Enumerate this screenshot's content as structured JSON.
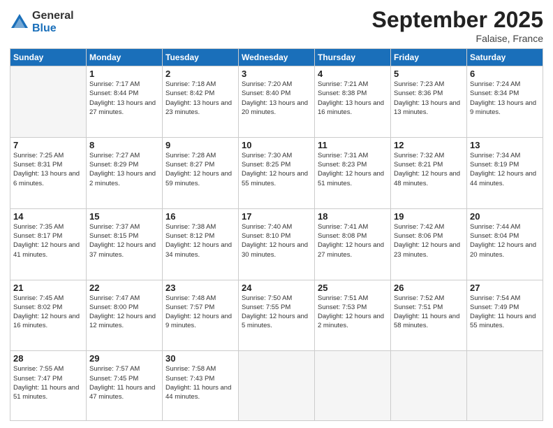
{
  "logo": {
    "general": "General",
    "blue": "Blue"
  },
  "title": "September 2025",
  "location": "Falaise, France",
  "days_of_week": [
    "Sunday",
    "Monday",
    "Tuesday",
    "Wednesday",
    "Thursday",
    "Friday",
    "Saturday"
  ],
  "weeks": [
    [
      {
        "day": "",
        "info": ""
      },
      {
        "day": "1",
        "info": "Sunrise: 7:17 AM\nSunset: 8:44 PM\nDaylight: 13 hours\nand 27 minutes."
      },
      {
        "day": "2",
        "info": "Sunrise: 7:18 AM\nSunset: 8:42 PM\nDaylight: 13 hours\nand 23 minutes."
      },
      {
        "day": "3",
        "info": "Sunrise: 7:20 AM\nSunset: 8:40 PM\nDaylight: 13 hours\nand 20 minutes."
      },
      {
        "day": "4",
        "info": "Sunrise: 7:21 AM\nSunset: 8:38 PM\nDaylight: 13 hours\nand 16 minutes."
      },
      {
        "day": "5",
        "info": "Sunrise: 7:23 AM\nSunset: 8:36 PM\nDaylight: 13 hours\nand 13 minutes."
      },
      {
        "day": "6",
        "info": "Sunrise: 7:24 AM\nSunset: 8:34 PM\nDaylight: 13 hours\nand 9 minutes."
      }
    ],
    [
      {
        "day": "7",
        "info": "Sunrise: 7:25 AM\nSunset: 8:31 PM\nDaylight: 13 hours\nand 6 minutes."
      },
      {
        "day": "8",
        "info": "Sunrise: 7:27 AM\nSunset: 8:29 PM\nDaylight: 13 hours\nand 2 minutes."
      },
      {
        "day": "9",
        "info": "Sunrise: 7:28 AM\nSunset: 8:27 PM\nDaylight: 12 hours\nand 59 minutes."
      },
      {
        "day": "10",
        "info": "Sunrise: 7:30 AM\nSunset: 8:25 PM\nDaylight: 12 hours\nand 55 minutes."
      },
      {
        "day": "11",
        "info": "Sunrise: 7:31 AM\nSunset: 8:23 PM\nDaylight: 12 hours\nand 51 minutes."
      },
      {
        "day": "12",
        "info": "Sunrise: 7:32 AM\nSunset: 8:21 PM\nDaylight: 12 hours\nand 48 minutes."
      },
      {
        "day": "13",
        "info": "Sunrise: 7:34 AM\nSunset: 8:19 PM\nDaylight: 12 hours\nand 44 minutes."
      }
    ],
    [
      {
        "day": "14",
        "info": "Sunrise: 7:35 AM\nSunset: 8:17 PM\nDaylight: 12 hours\nand 41 minutes."
      },
      {
        "day": "15",
        "info": "Sunrise: 7:37 AM\nSunset: 8:15 PM\nDaylight: 12 hours\nand 37 minutes."
      },
      {
        "day": "16",
        "info": "Sunrise: 7:38 AM\nSunset: 8:12 PM\nDaylight: 12 hours\nand 34 minutes."
      },
      {
        "day": "17",
        "info": "Sunrise: 7:40 AM\nSunset: 8:10 PM\nDaylight: 12 hours\nand 30 minutes."
      },
      {
        "day": "18",
        "info": "Sunrise: 7:41 AM\nSunset: 8:08 PM\nDaylight: 12 hours\nand 27 minutes."
      },
      {
        "day": "19",
        "info": "Sunrise: 7:42 AM\nSunset: 8:06 PM\nDaylight: 12 hours\nand 23 minutes."
      },
      {
        "day": "20",
        "info": "Sunrise: 7:44 AM\nSunset: 8:04 PM\nDaylight: 12 hours\nand 20 minutes."
      }
    ],
    [
      {
        "day": "21",
        "info": "Sunrise: 7:45 AM\nSunset: 8:02 PM\nDaylight: 12 hours\nand 16 minutes."
      },
      {
        "day": "22",
        "info": "Sunrise: 7:47 AM\nSunset: 8:00 PM\nDaylight: 12 hours\nand 12 minutes."
      },
      {
        "day": "23",
        "info": "Sunrise: 7:48 AM\nSunset: 7:57 PM\nDaylight: 12 hours\nand 9 minutes."
      },
      {
        "day": "24",
        "info": "Sunrise: 7:50 AM\nSunset: 7:55 PM\nDaylight: 12 hours\nand 5 minutes."
      },
      {
        "day": "25",
        "info": "Sunrise: 7:51 AM\nSunset: 7:53 PM\nDaylight: 12 hours\nand 2 minutes."
      },
      {
        "day": "26",
        "info": "Sunrise: 7:52 AM\nSunset: 7:51 PM\nDaylight: 11 hours\nand 58 minutes."
      },
      {
        "day": "27",
        "info": "Sunrise: 7:54 AM\nSunset: 7:49 PM\nDaylight: 11 hours\nand 55 minutes."
      }
    ],
    [
      {
        "day": "28",
        "info": "Sunrise: 7:55 AM\nSunset: 7:47 PM\nDaylight: 11 hours\nand 51 minutes."
      },
      {
        "day": "29",
        "info": "Sunrise: 7:57 AM\nSunset: 7:45 PM\nDaylight: 11 hours\nand 47 minutes."
      },
      {
        "day": "30",
        "info": "Sunrise: 7:58 AM\nSunset: 7:43 PM\nDaylight: 11 hours\nand 44 minutes."
      },
      {
        "day": "",
        "info": ""
      },
      {
        "day": "",
        "info": ""
      },
      {
        "day": "",
        "info": ""
      },
      {
        "day": "",
        "info": ""
      }
    ]
  ]
}
